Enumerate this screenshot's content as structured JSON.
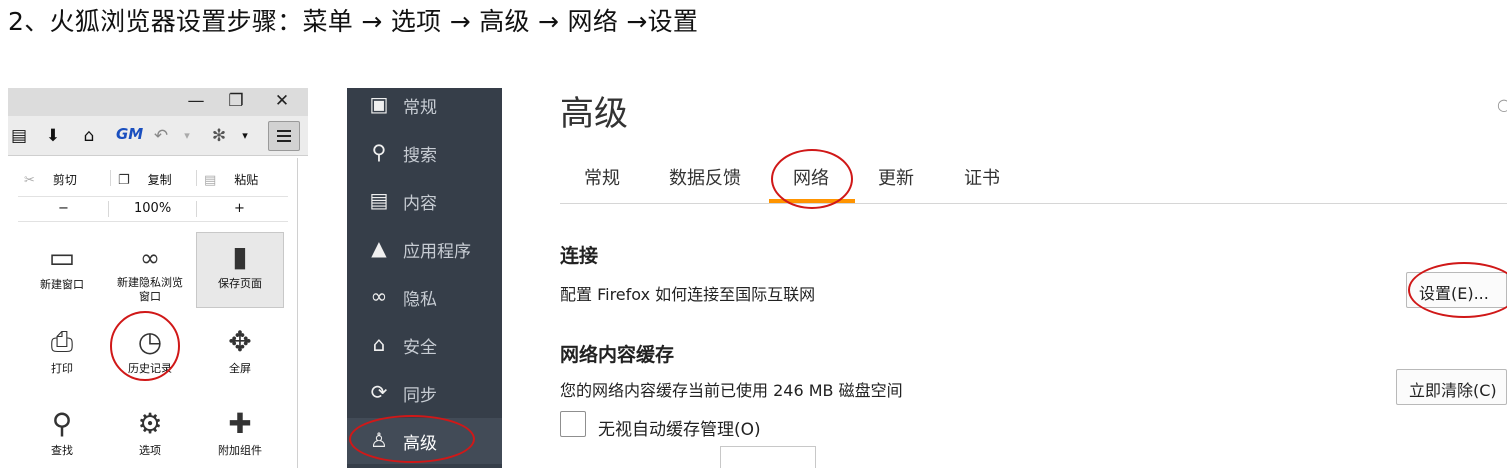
{
  "heading": "2、火狐浏览器设置步骤：菜单 → 选项 → 高级 → 网络 →设置",
  "firefox_window": {
    "window_controls": [
      "—",
      "❐",
      "✕"
    ],
    "gm_icon": "GM",
    "edit_row": {
      "cut": "剪切",
      "copy": "复制",
      "paste": "粘贴"
    },
    "zoom_row": {
      "minus": "−",
      "zoom": "100%",
      "plus": "+"
    },
    "menu_items": [
      {
        "label": "新建窗口",
        "icon": "new-window-icon"
      },
      {
        "label": "新建隐私浏览\n窗口",
        "icon": "private-mask-icon"
      },
      {
        "label": "保存页面",
        "icon": "save-page-icon"
      },
      {
        "label": "打印",
        "icon": "print-icon"
      },
      {
        "label": "历史记录",
        "icon": "history-icon"
      },
      {
        "label": "全屏",
        "icon": "fullscreen-icon"
      },
      {
        "label": "查找",
        "icon": "find-icon"
      },
      {
        "label": "选项",
        "icon": "options-gear-icon"
      },
      {
        "label": "附加组件",
        "icon": "addons-puzzle-icon"
      }
    ]
  },
  "sidebar": {
    "items": [
      {
        "label": "常规",
        "icon": "general-icon"
      },
      {
        "label": "搜索",
        "icon": "search-icon"
      },
      {
        "label": "内容",
        "icon": "content-icon"
      },
      {
        "label": "应用程序",
        "icon": "applications-icon"
      },
      {
        "label": "隐私",
        "icon": "privacy-icon"
      },
      {
        "label": "安全",
        "icon": "security-icon"
      },
      {
        "label": "同步",
        "icon": "sync-icon"
      },
      {
        "label": "高级",
        "icon": "advanced-icon"
      }
    ],
    "active": "高级"
  },
  "content": {
    "title": "高级",
    "tabs": [
      "常规",
      "数据反馈",
      "网络",
      "更新",
      "证书"
    ],
    "active_tab": "网络",
    "connection": {
      "heading": "连接",
      "description": "配置 Firefox 如何连接至国际互联网",
      "button": "设置(E)..."
    },
    "cache": {
      "heading": "网络内容缓存",
      "description": "您的网络内容缓存当前已使用 246 MB 磁盘空间",
      "button": "立即清除(C)",
      "checkbox_label": "无视自动缓存管理(O)"
    }
  },
  "colors": {
    "sidebar_bg": "#363e49",
    "tab_accent": "#ff9400",
    "annotation_red": "#d01818"
  }
}
